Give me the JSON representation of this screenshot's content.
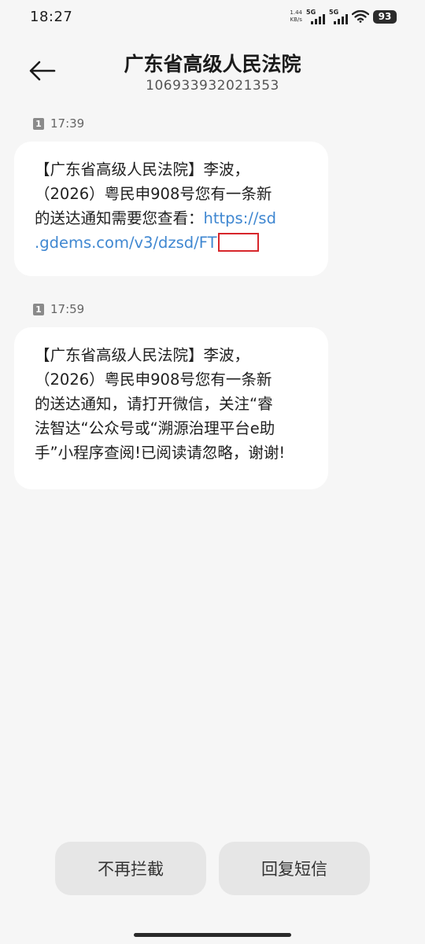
{
  "status_bar": {
    "time": "18:27",
    "net_speed_value": "1.44",
    "net_speed_unit": "KB/s",
    "sim1_label": "5G",
    "sim2_label": "5G",
    "battery": "93"
  },
  "header": {
    "title": "广东省高级人民法院",
    "number": "106933932021353"
  },
  "messages": [
    {
      "sim": "1",
      "time": "17:39",
      "lines": [
        "【广东省高级人民法院】李波，",
        "（2026）粤民申908号您有一条新",
        "的送达通知需要您查看："
      ],
      "link_part1": "https://sd",
      "link_part2": ".gdems.com/v3/dzsd/FT"
    },
    {
      "sim": "1",
      "time": "17:59",
      "lines": [
        "【广东省高级人民法院】李波，",
        "（2026）粤民申908号您有一条新",
        "的送达通知，请打开微信，关注“睿",
        "法智达“公众号或“溯源治理平台e助",
        "手”小程序查阅!已阅读请忽略，谢谢!"
      ]
    }
  ],
  "actions": {
    "unblock_label": "不再拦截",
    "reply_label": "回复短信"
  },
  "colors": {
    "background": "#f6f6f6",
    "bubble": "#ffffff",
    "link": "#3f87d1",
    "highlight_box": "#d7262b"
  }
}
